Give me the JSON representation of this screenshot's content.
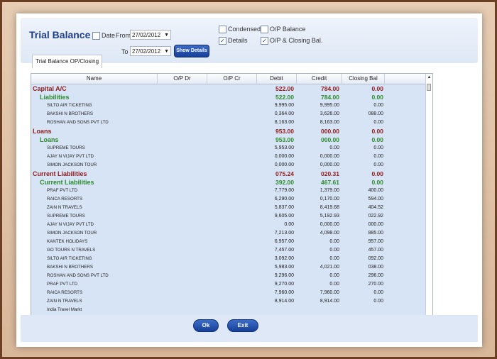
{
  "header": {
    "title": "Trial Balance",
    "date_label": "Date",
    "from_label": "From",
    "from_value": "27/02/2012",
    "to_label": "To",
    "to_value": "27/02/2012",
    "show_details": "Show Details",
    "tab": "Trial Balance OP/Closing"
  },
  "options": {
    "condensed": {
      "label": "Condensed",
      "checked": false
    },
    "op_balance": {
      "label": "O/P Balance",
      "checked": false
    },
    "details": {
      "label": "Details",
      "checked": true
    },
    "op_closing": {
      "label": "O/P & Closing Bal.",
      "checked": true
    }
  },
  "columns": {
    "name": "Name",
    "op_dr": "O/P Dr",
    "op_cr": "O/P Cr",
    "debit": "Debit",
    "credit": "Credit",
    "closing": "Closing Bal"
  },
  "rows": [
    {
      "level": "group",
      "name": "Capital A/C",
      "debit": "522.00",
      "credit": "784.00",
      "closing": "0.00"
    },
    {
      "level": "sub",
      "name": "Liabilities",
      "debit": "522.00",
      "credit": "784.00",
      "closing": "0.00"
    },
    {
      "level": "item",
      "name": "SILTO AIR TICKETING",
      "debit": "9,995.00",
      "credit": "9,995.00",
      "closing": "0.00"
    },
    {
      "level": "item",
      "name": "BAKSHI N BROTHERS",
      "debit": "0,364.00",
      "credit": "3,626.00",
      "closing": "088.00"
    },
    {
      "level": "item",
      "name": "ROSHAN AND SONS PVT LTD",
      "debit": "8,163.00",
      "credit": "8,163.00",
      "closing": "0.00"
    },
    {
      "level": "group",
      "name": "Loans",
      "debit": "953.00",
      "credit": "000.00",
      "closing": "0.00"
    },
    {
      "level": "sub",
      "name": "Loans",
      "debit": "953.00",
      "credit": "000.00",
      "closing": "0.00"
    },
    {
      "level": "item",
      "name": "SUPREME TOURS",
      "debit": "5,953.00",
      "credit": "0.00",
      "closing": "0.00"
    },
    {
      "level": "item",
      "name": "AJAY N VIJAY PVT LTD",
      "debit": "0,000.00",
      "credit": "0,000.00",
      "closing": "0.00"
    },
    {
      "level": "item",
      "name": "SIMON JACKSON TOUR",
      "debit": "0,000.00",
      "credit": "0,000.00",
      "closing": "0.00"
    },
    {
      "level": "group",
      "name": "Current Liabilities",
      "debit": "075.24",
      "credit": "020.31",
      "closing": "0.00"
    },
    {
      "level": "sub",
      "name": "Current Liabilities",
      "debit": "392.00",
      "credit": "467.61",
      "closing": "0.00"
    },
    {
      "level": "item",
      "name": "PRAF PVT LTD",
      "debit": "7,779.00",
      "credit": "1,379.00",
      "closing": "400.00"
    },
    {
      "level": "item",
      "name": "RAICA RESORTS",
      "debit": "6,290.00",
      "credit": "0,170.00",
      "closing": "594.00"
    },
    {
      "level": "item",
      "name": "ZAIN N TRAVELS",
      "debit": "5,837.00",
      "credit": "8,419.68",
      "closing": "404.52"
    },
    {
      "level": "item",
      "name": "SUPREME TOURS",
      "debit": "9,605.00",
      "credit": "5,192.93",
      "closing": "022.92"
    },
    {
      "level": "item",
      "name": "AJAY N VIJAY PVT LTD",
      "debit": "0.00",
      "credit": "0,000.00",
      "closing": "000.00"
    },
    {
      "level": "item",
      "name": "SIMON JACKSON TOUR",
      "debit": "7,213.00",
      "credit": "4,098.00",
      "closing": "885.00"
    },
    {
      "level": "item",
      "name": "KANTEK HOLIDAYS",
      "debit": "6,957.00",
      "credit": "0.00",
      "closing": "957.00"
    },
    {
      "level": "item",
      "name": "GO TOURS N TRAVELS",
      "debit": "7,457.00",
      "credit": "0.00",
      "closing": "457.00"
    },
    {
      "level": "item",
      "name": "SILTO AIR TICKETING",
      "debit": "3,092.00",
      "credit": "0.00",
      "closing": "092.00"
    },
    {
      "level": "item",
      "name": "BAKSHI N BROTHERS",
      "debit": "5,983.00",
      "credit": "4,021.00",
      "closing": "038.00"
    },
    {
      "level": "item",
      "name": "ROSHAN AND SONS PVT LTD",
      "debit": "9,296.00",
      "credit": "0.00",
      "closing": "296.00"
    },
    {
      "level": "item",
      "name": "PRAF PVT LTD",
      "debit": "9,270.00",
      "credit": "0.00",
      "closing": "270.00"
    },
    {
      "level": "item",
      "name": "RAICA RESORTS",
      "debit": "7,960.00",
      "credit": "7,960.00",
      "closing": "0.00"
    },
    {
      "level": "item",
      "name": "ZAIN N TRAVELS",
      "debit": "8,914.00",
      "credit": "8,914.00",
      "closing": "0.00"
    },
    {
      "level": "item",
      "name": "India Travel Markt",
      "debit": "",
      "credit": "",
      "closing": ""
    }
  ],
  "footer": {
    "ok": "Ok",
    "exit": "Exit"
  }
}
